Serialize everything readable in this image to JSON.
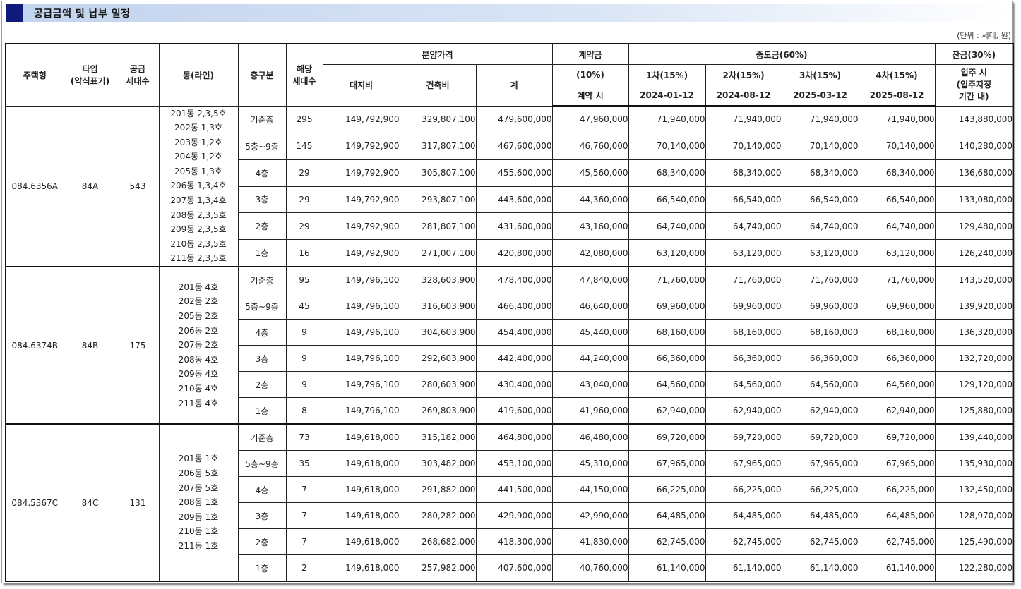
{
  "title": "공급금액 및 납부 일정",
  "unit": "(단위 : 세대, 원)",
  "headers": {
    "housing_type": "주택형",
    "type_line1": "타입",
    "type_line2": "(약식표기)",
    "supply_line1": "공급",
    "supply_line2": "세대수",
    "dong": "동(라인)",
    "floor": "층구분",
    "units_line1": "해당",
    "units_line2": "세대수",
    "price": "분양가격",
    "land": "대지비",
    "building": "건축비",
    "total": "계",
    "contract": "계약금",
    "contract_pct": "(10%)",
    "contract_when": "계약 시",
    "middle": "중도금(60%)",
    "m1": "1차(15%)",
    "m2": "2차(15%)",
    "m3": "3차(15%)",
    "m4": "4차(15%)",
    "m1_date": "2024-01-12",
    "m2_date": "2024-08-12",
    "m3_date": "2025-03-12",
    "m4_date": "2025-08-12",
    "balance": "잔금(30%)",
    "balance_l1": "입주 시",
    "balance_l2": "(입주지정",
    "balance_l3": "기간 내)"
  },
  "groups": [
    {
      "housing_type": "084.6356A",
      "type": "84A",
      "supply": "543",
      "dongs": [
        "201동 2,3,5호",
        "202동 1,3호",
        "203동 1,2호",
        "204동 1,2호",
        "205동 1,3호",
        "206동 1,3,4호",
        "207동 1,3,4호",
        "208동 2,3,5호",
        "209동 2,3,5호",
        "210동 2,3,5호",
        "211동 2,3,5호"
      ],
      "rows": [
        {
          "floor": "기준층",
          "units": "295",
          "land": "149,792,900",
          "building": "329,807,100",
          "total": "479,600,000",
          "contract": "47,960,000",
          "m1": "71,940,000",
          "m2": "71,940,000",
          "m3": "71,940,000",
          "m4": "71,940,000",
          "balance": "143,880,000"
        },
        {
          "floor": "5층~9층",
          "units": "145",
          "land": "149,792,900",
          "building": "317,807,100",
          "total": "467,600,000",
          "contract": "46,760,000",
          "m1": "70,140,000",
          "m2": "70,140,000",
          "m3": "70,140,000",
          "m4": "70,140,000",
          "balance": "140,280,000"
        },
        {
          "floor": "4층",
          "units": "29",
          "land": "149,792,900",
          "building": "305,807,100",
          "total": "455,600,000",
          "contract": "45,560,000",
          "m1": "68,340,000",
          "m2": "68,340,000",
          "m3": "68,340,000",
          "m4": "68,340,000",
          "balance": "136,680,000"
        },
        {
          "floor": "3층",
          "units": "29",
          "land": "149,792,900",
          "building": "293,807,100",
          "total": "443,600,000",
          "contract": "44,360,000",
          "m1": "66,540,000",
          "m2": "66,540,000",
          "m3": "66,540,000",
          "m4": "66,540,000",
          "balance": "133,080,000"
        },
        {
          "floor": "2층",
          "units": "29",
          "land": "149,792,900",
          "building": "281,807,100",
          "total": "431,600,000",
          "contract": "43,160,000",
          "m1": "64,740,000",
          "m2": "64,740,000",
          "m3": "64,740,000",
          "m4": "64,740,000",
          "balance": "129,480,000"
        },
        {
          "floor": "1층",
          "units": "16",
          "land": "149,792,900",
          "building": "271,007,100",
          "total": "420,800,000",
          "contract": "42,080,000",
          "m1": "63,120,000",
          "m2": "63,120,000",
          "m3": "63,120,000",
          "m4": "63,120,000",
          "balance": "126,240,000"
        }
      ]
    },
    {
      "housing_type": "084.6374B",
      "type": "84B",
      "supply": "175",
      "dongs": [
        "201동 4호",
        "202동 2호",
        "205동 2호",
        "206동 2호",
        "207동 2호",
        "208동 4호",
        "209동 4호",
        "210동 4호",
        "211동 4호"
      ],
      "rows": [
        {
          "floor": "기준층",
          "units": "95",
          "land": "149,796,100",
          "building": "328,603,900",
          "total": "478,400,000",
          "contract": "47,840,000",
          "m1": "71,760,000",
          "m2": "71,760,000",
          "m3": "71,760,000",
          "m4": "71,760,000",
          "balance": "143,520,000"
        },
        {
          "floor": "5층~9층",
          "units": "45",
          "land": "149,796,100",
          "building": "316,603,900",
          "total": "466,400,000",
          "contract": "46,640,000",
          "m1": "69,960,000",
          "m2": "69,960,000",
          "m3": "69,960,000",
          "m4": "69,960,000",
          "balance": "139,920,000"
        },
        {
          "floor": "4층",
          "units": "9",
          "land": "149,796,100",
          "building": "304,603,900",
          "total": "454,400,000",
          "contract": "45,440,000",
          "m1": "68,160,000",
          "m2": "68,160,000",
          "m3": "68,160,000",
          "m4": "68,160,000",
          "balance": "136,320,000"
        },
        {
          "floor": "3층",
          "units": "9",
          "land": "149,796,100",
          "building": "292,603,900",
          "total": "442,400,000",
          "contract": "44,240,000",
          "m1": "66,360,000",
          "m2": "66,360,000",
          "m3": "66,360,000",
          "m4": "66,360,000",
          "balance": "132,720,000"
        },
        {
          "floor": "2층",
          "units": "9",
          "land": "149,796,100",
          "building": "280,603,900",
          "total": "430,400,000",
          "contract": "43,040,000",
          "m1": "64,560,000",
          "m2": "64,560,000",
          "m3": "64,560,000",
          "m4": "64,560,000",
          "balance": "129,120,000"
        },
        {
          "floor": "1층",
          "units": "8",
          "land": "149,796,100",
          "building": "269,803,900",
          "total": "419,600,000",
          "contract": "41,960,000",
          "m1": "62,940,000",
          "m2": "62,940,000",
          "m3": "62,940,000",
          "m4": "62,940,000",
          "balance": "125,880,000"
        }
      ]
    },
    {
      "housing_type": "084.5367C",
      "type": "84C",
      "supply": "131",
      "dongs": [
        "201동 1호",
        "206동 5호",
        "207동 5호",
        "208동 1호",
        "209동 1호",
        "210동 1호",
        "211동 1호"
      ],
      "rows": [
        {
          "floor": "기준층",
          "units": "73",
          "land": "149,618,000",
          "building": "315,182,000",
          "total": "464,800,000",
          "contract": "46,480,000",
          "m1": "69,720,000",
          "m2": "69,720,000",
          "m3": "69,720,000",
          "m4": "69,720,000",
          "balance": "139,440,000"
        },
        {
          "floor": "5층~9층",
          "units": "35",
          "land": "149,618,000",
          "building": "303,482,000",
          "total": "453,100,000",
          "contract": "45,310,000",
          "m1": "67,965,000",
          "m2": "67,965,000",
          "m3": "67,965,000",
          "m4": "67,965,000",
          "balance": "135,930,000"
        },
        {
          "floor": "4층",
          "units": "7",
          "land": "149,618,000",
          "building": "291,882,000",
          "total": "441,500,000",
          "contract": "44,150,000",
          "m1": "66,225,000",
          "m2": "66,225,000",
          "m3": "66,225,000",
          "m4": "66,225,000",
          "balance": "132,450,000"
        },
        {
          "floor": "3층",
          "units": "7",
          "land": "149,618,000",
          "building": "280,282,000",
          "total": "429,900,000",
          "contract": "42,990,000",
          "m1": "64,485,000",
          "m2": "64,485,000",
          "m3": "64,485,000",
          "m4": "64,485,000",
          "balance": "128,970,000"
        },
        {
          "floor": "2층",
          "units": "7",
          "land": "149,618,000",
          "building": "268,682,000",
          "total": "418,300,000",
          "contract": "41,830,000",
          "m1": "62,745,000",
          "m2": "62,745,000",
          "m3": "62,745,000",
          "m4": "62,745,000",
          "balance": "125,490,000"
        },
        {
          "floor": "1층",
          "units": "2",
          "land": "149,618,000",
          "building": "257,982,000",
          "total": "407,600,000",
          "contract": "40,760,000",
          "m1": "61,140,000",
          "m2": "61,140,000",
          "m3": "61,140,000",
          "m4": "61,140,000",
          "balance": "122,280,000"
        }
      ]
    }
  ]
}
